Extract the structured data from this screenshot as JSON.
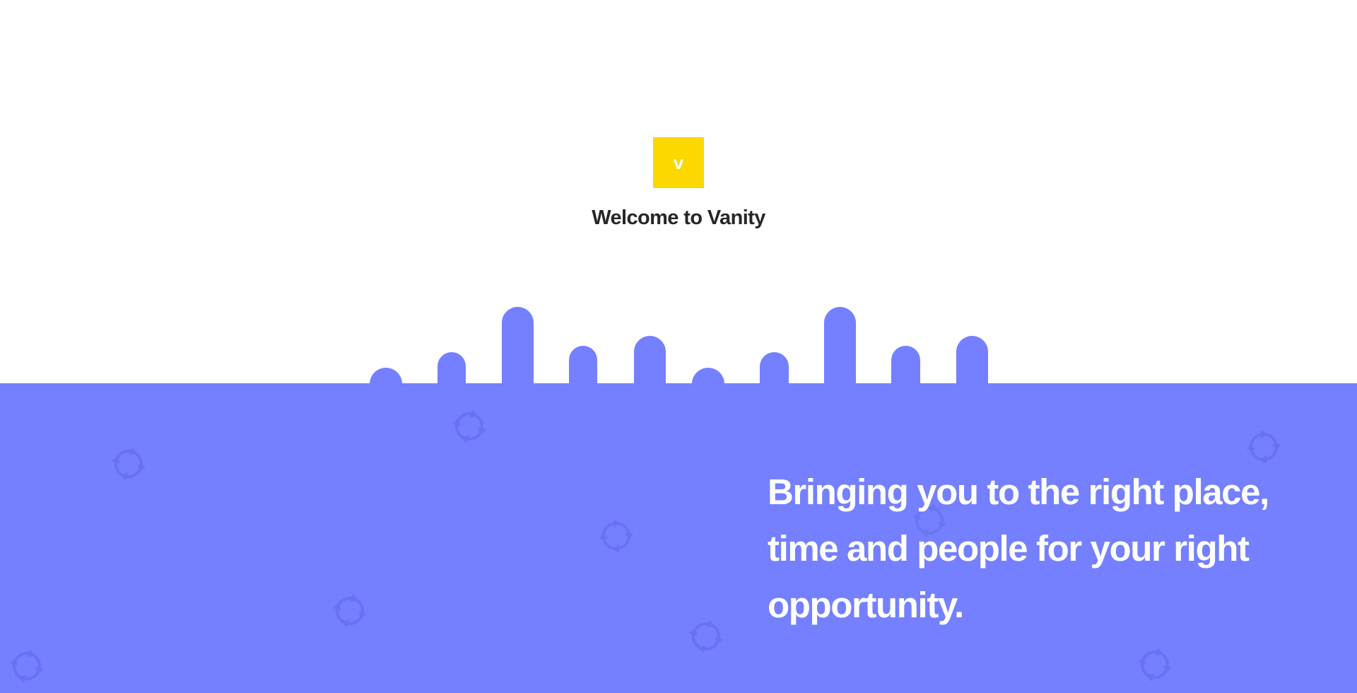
{
  "brand": {
    "logo_letter": "v",
    "logo_color": "#fcd700",
    "welcome_title": "Welcome to Vanity"
  },
  "hero": {
    "background_color": "#7480ff",
    "tagline": "Bringing you to the right place, time and people for your right opportunity."
  },
  "decorations": {
    "icon": "circular-arrows-icon",
    "color": "#6872ee"
  }
}
